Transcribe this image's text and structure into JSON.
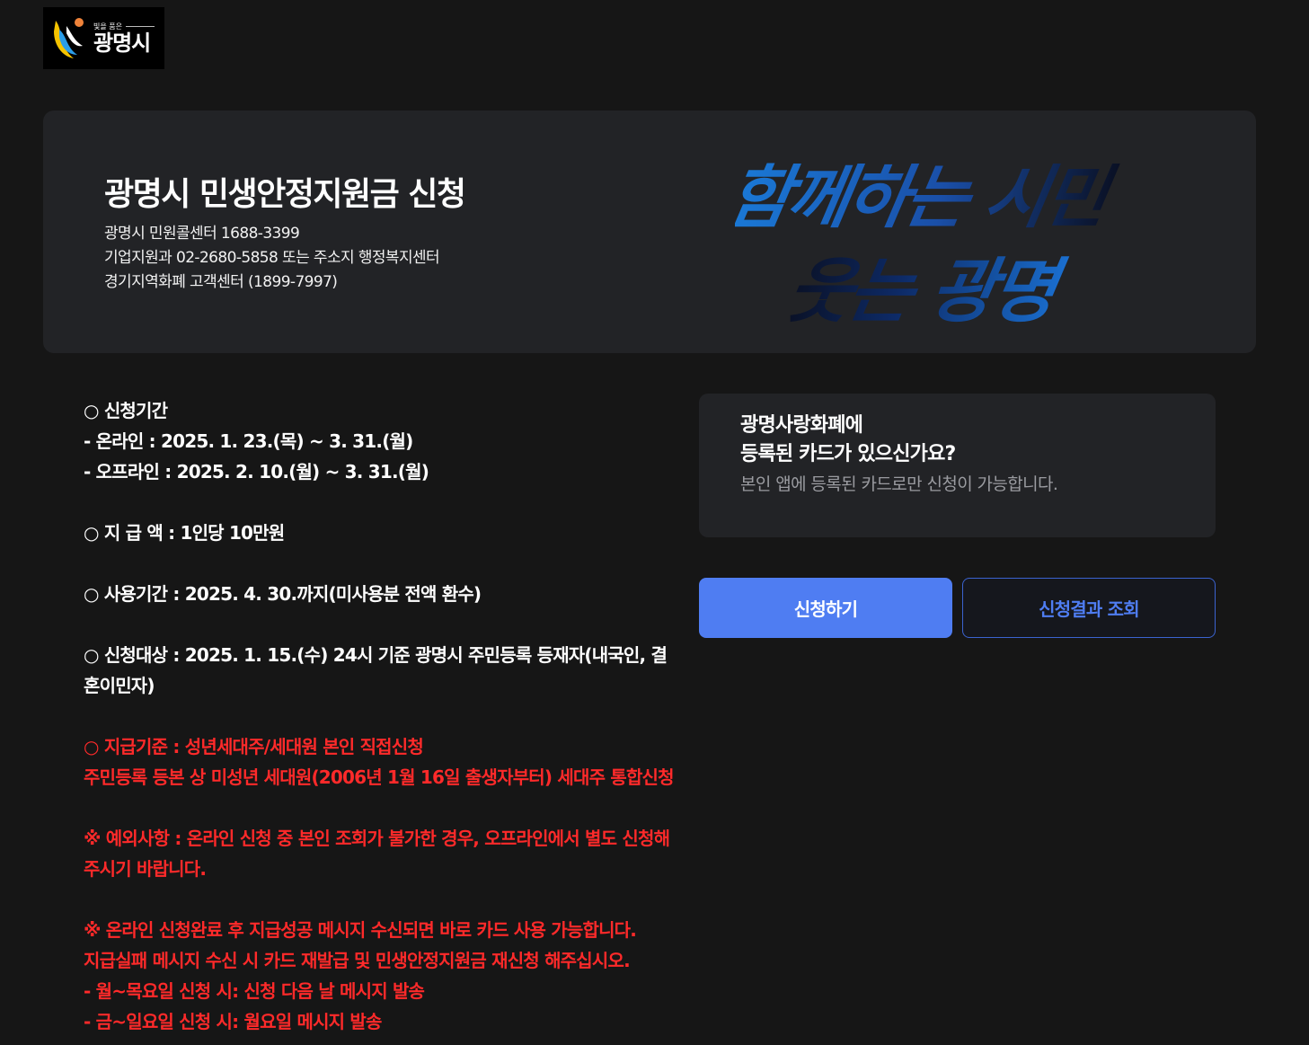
{
  "header": {
    "logo_slogan": "빛을 품은",
    "logo_name": "광명시"
  },
  "hero": {
    "title": "광명시 민생안정지원금 신청",
    "lines": [
      "광명시 민원콜센터 1688-3399",
      "기업지원과 02-2680-5858 또는 주소지 행정복지센터",
      "경기지역화폐 고객센터 (1899-7997)"
    ],
    "calligraphy_line1": "함께하는 시민",
    "calligraphy_line2": "웃는 광명",
    "colors": {
      "calligraphy_blue": "#1a6fd0",
      "calligraphy_dark": "#0a1024"
    }
  },
  "info": {
    "period_title": "○ 신청기간",
    "period_online": "- 온라인 : 2025. 1. 23.(목) ~ 3. 31.(월)",
    "period_offline": "- 오프라인 : 2025. 2. 10.(월) ~ 3. 31.(월)",
    "amount": "○ 지 급 액 : 1인당 10만원",
    "usage": "○ 사용기간 : 2025. 4. 30.까지(미사용분 전액 환수)",
    "target": "○ 신청대상 : 2025. 1. 15.(수) 24시 기준 광명시 주민등록 등재자(내국인, 결혼이민자)",
    "criteria_1": "○ 지급기준 : 성년세대주/세대원 본인 직접신청",
    "criteria_2": "주민등록 등본 상 미성년 세대원(2006년 1월 16일 출생자부터) 세대주 통합신청",
    "exception": "※ 예외사항 : 온라인 신청 중 본인 조회가 불가한 경우, 오프라인에서 별도 신청해주시기 바랍니다.",
    "note_1": "※ 온라인 신청완료 후 지급성공 메시지 수신되면 바로 카드 사용 가능합니다.",
    "note_2": "지급실패 메시지 수신 시 카드 재발급 및 민생안정지원금 재신청 해주십시오.",
    "note_3": "- 월~목요일 신청 시: 신청 다음 날 메시지 발송",
    "note_4": "- 금~일요일 신청 시: 월요일 메시지 발송"
  },
  "card": {
    "title_line1": "광명사랑화폐에",
    "title_line2": "등록된 카드가 있으신가요?",
    "description": "본인 앱에 등록된 카드로만 신청이 가능합니다."
  },
  "buttons": {
    "apply": "신청하기",
    "result": "신청결과 조회"
  },
  "colors": {
    "accent": "#4f7df2",
    "warning_red": "#ff2a2a",
    "background": "#161616",
    "panel": "#222326"
  }
}
